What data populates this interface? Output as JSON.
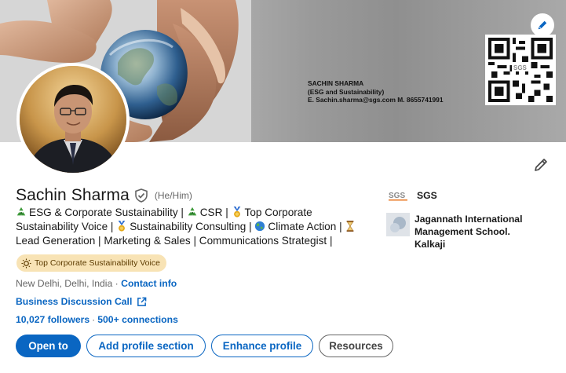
{
  "cover": {
    "card_name": "SACHIN SHARMA",
    "card_subtitle": "(ESG and Sustainability)",
    "card_contact": "E. Sachin.sharma@sgs.com M. 8655741991",
    "qr_label": "SGS",
    "edit_icon": "pencil-icon"
  },
  "profile": {
    "name": "Sachin Sharma",
    "pronouns": "(He/Him)",
    "verified_icon": "verified-shield-icon",
    "headline": [
      {
        "icon": "recycle-icon",
        "text": "ESG & Corporate Sustainability |"
      },
      {
        "icon": "recycle-icon",
        "text": "CSR |"
      },
      {
        "icon": "medal-icon",
        "text": "Top Corporate Sustainability Voice |"
      },
      {
        "icon": "medal-icon",
        "text": "Sustainability Consulting |"
      },
      {
        "icon": "globe-icon",
        "text": "Climate Action |"
      },
      {
        "icon": "hourglass-icon",
        "text": "Lead Generation | Marketing & Sales | Communications Strategist |"
      }
    ],
    "badge": "Top Corporate Sustainability Voice",
    "location": "New Delhi, Delhi, India",
    "location_sep": " · ",
    "contact_info": "Contact info",
    "website": "Business Discussion Call",
    "followers": "10,027 followers",
    "followers_sep": "·",
    "connections": "500+ connections"
  },
  "actions": {
    "open_to": "Open to",
    "add_section": "Add profile section",
    "enhance": "Enhance profile",
    "resources": "Resources"
  },
  "orgs": [
    {
      "name": "SGS",
      "logo": "sgs-logo"
    },
    {
      "name": "Jagannath International Management School. Kalkaji",
      "logo": "school-logo"
    }
  ],
  "colors": {
    "accent": "#0a66c2",
    "badge_bg": "#f8e3b5",
    "text": "#191919",
    "muted": "#666666"
  }
}
